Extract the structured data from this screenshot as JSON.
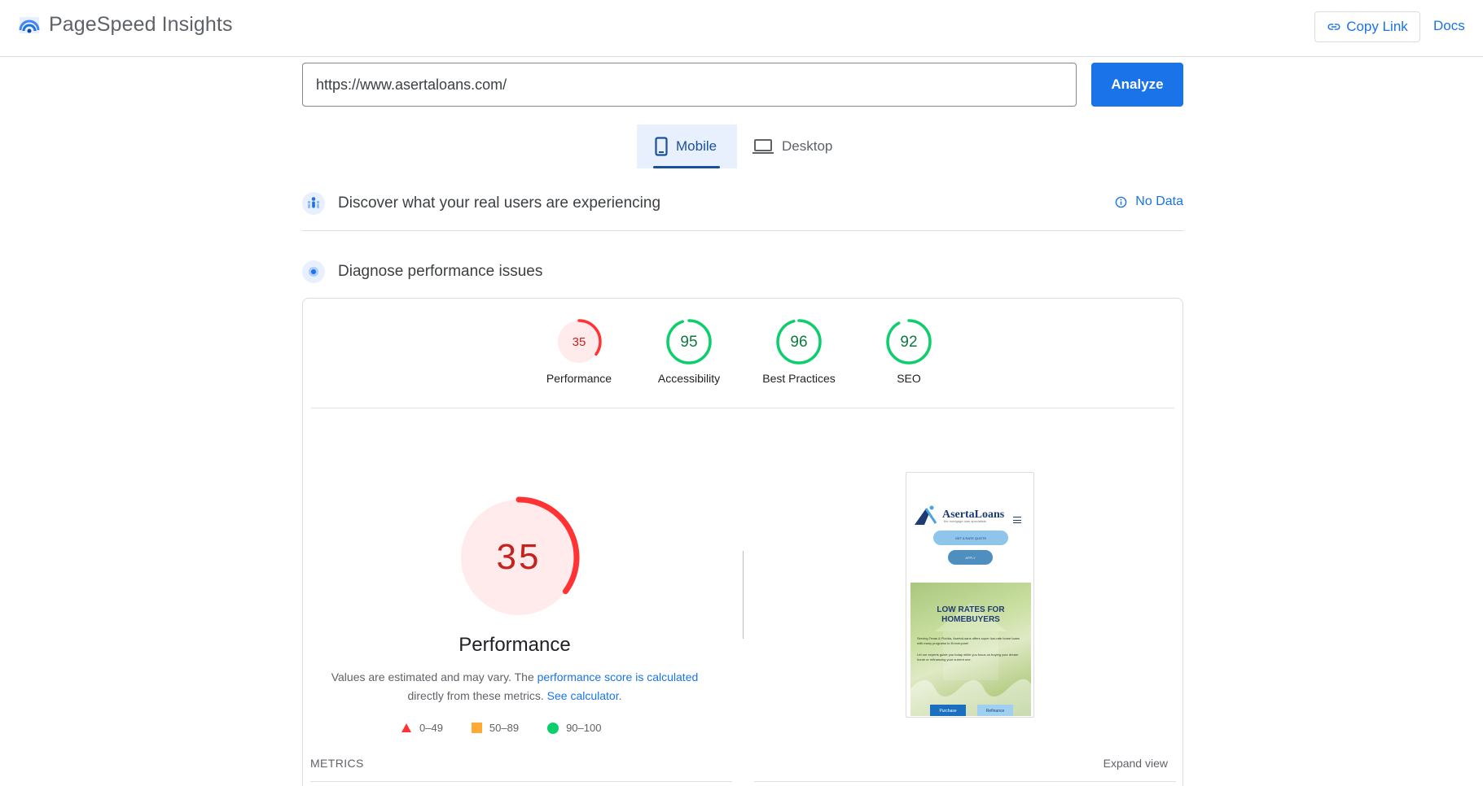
{
  "header": {
    "title": "PageSpeed Insights",
    "copy_link": "Copy Link",
    "docs": "Docs"
  },
  "url_bar": {
    "value": "https://www.asertaloans.com/",
    "analyze": "Analyze"
  },
  "device_tabs": [
    {
      "label": "Mobile",
      "icon": "phone-icon",
      "active": true
    },
    {
      "label": "Desktop",
      "icon": "laptop-icon",
      "active": false
    }
  ],
  "field_data": {
    "title": "Discover what your real users are experiencing",
    "status": "No Data"
  },
  "lab_data": {
    "title": "Diagnose performance issues"
  },
  "categories": [
    {
      "label": "Performance",
      "score": 35,
      "rating": "fail"
    },
    {
      "label": "Accessibility",
      "score": 95,
      "rating": "pass"
    },
    {
      "label": "Best Practices",
      "score": 96,
      "rating": "pass"
    },
    {
      "label": "SEO",
      "score": 92,
      "rating": "pass"
    }
  ],
  "performance": {
    "score": "35",
    "title": "Performance",
    "desc_1": "Values are estimated and may vary. The ",
    "desc_link_1": "performance score is calculated",
    "desc_2": "directly from these metrics. ",
    "desc_link_2": "See calculator."
  },
  "legend": [
    {
      "range": "0–49",
      "color": "#ff3333",
      "shape": "triangle"
    },
    {
      "range": "50–89",
      "color": "#ffaa33",
      "shape": "square"
    },
    {
      "range": "90–100",
      "color": "#0cce6b",
      "shape": "circle"
    }
  ],
  "screenshot": {
    "brand": "AsertaLoans",
    "tagline": "the mortgage loan specialists",
    "btn1": "GET A RATE QUOTE",
    "btn2": "APPLY",
    "hero_title_1": "LOW RATES FOR",
    "hero_title_2": "HOMEBUYERS",
    "hero_text_1": "Serving Texas & Florida, AsertaLoans offers super low-rate home loans with many programs to fit everyone!",
    "hero_text_2": "Let our experts guide you today while you focus on buying your dream home or refinancing your current one.",
    "hero_btn_1": "Purchase",
    "hero_btn_2": "Refinance"
  },
  "metrics": {
    "label": "METRICS",
    "expand": "Expand view"
  },
  "colors": {
    "accent": "#1a73e8",
    "fail": "#ff3333",
    "pass": "#0cce6b"
  }
}
